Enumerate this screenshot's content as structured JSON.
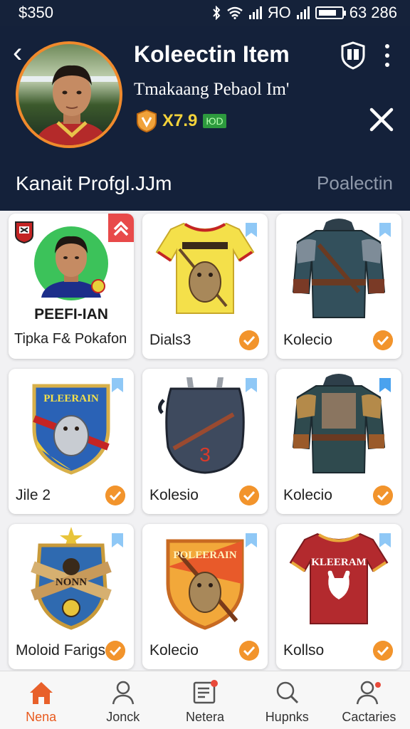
{
  "status_bar": {
    "time": "$350",
    "network": "ЯO",
    "right_text": "63 286"
  },
  "header": {
    "title": "Koleectin Item",
    "subtitle": "Tmakaang Pebaol Im'",
    "price": "X7.9",
    "price_badge": "ЮD",
    "profile_label": "Kanait Profgl.JJm",
    "collection_link": "Poalectin"
  },
  "colors": {
    "header_bg": "#14213a",
    "accent_orange": "#f2942c",
    "bookmark_blue": "#6bb4f2",
    "active_nav": "#e85a1e"
  },
  "cards": [
    {
      "type": "profile",
      "name": "PEEFI-IAN",
      "label": "Tipka F& Pokafon",
      "icon": "player-portrait"
    },
    {
      "label": "Dials3",
      "icon": "yellow-jersey-icon"
    },
    {
      "label": "Kolecio",
      "icon": "armored-jacket-icon"
    },
    {
      "label": "Jile 2",
      "icon": "crest-shield-icon",
      "crest_text": "PLEERAIN"
    },
    {
      "label": "Kolesio",
      "icon": "bag-icon",
      "bag_number": "3"
    },
    {
      "label": "Kolecio",
      "icon": "armored-jacket-icon"
    },
    {
      "label": "Moloid Farigs",
      "icon": "emblem-icon",
      "emblem_text": "NONN"
    },
    {
      "label": "Kolecio",
      "icon": "crest-shield-icon",
      "crest_text": "POLEERAIN"
    },
    {
      "label": "Kollso",
      "icon": "red-jersey-icon",
      "jersey_text": "KLEERAM"
    }
  ],
  "nav": [
    {
      "label": "Nena",
      "icon": "home-icon",
      "active": true
    },
    {
      "label": "Jonck",
      "icon": "person-icon"
    },
    {
      "label": "Netera",
      "icon": "news-icon"
    },
    {
      "label": "Hupnks",
      "icon": "search-icon"
    },
    {
      "label": "Cactaries",
      "icon": "profile-alert-icon"
    }
  ]
}
